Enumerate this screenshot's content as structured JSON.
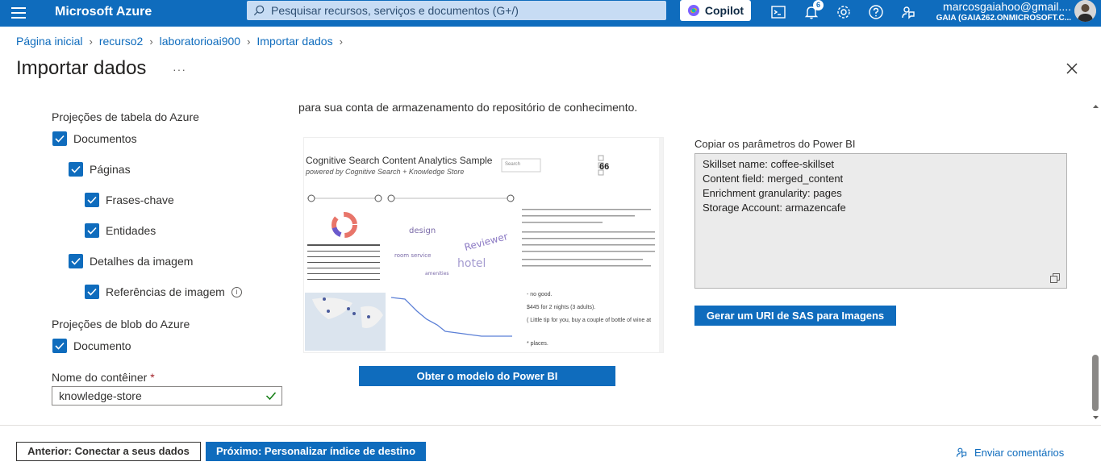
{
  "header": {
    "brand": "Microsoft Azure",
    "search_placeholder": "Pesquisar recursos, serviços e documentos (G+/)",
    "copilot_label": "Copilot",
    "notification_count": "6",
    "account_name": "marcosgaiahoo@gmail....",
    "account_tenant": "GAIA (GAIA262.ONMICROSOFT.C...",
    "icons": [
      "menu-icon",
      "search-icon",
      "cloud-shell-icon",
      "bell-icon",
      "settings-icon",
      "help-icon",
      "feedback-icon"
    ]
  },
  "breadcrumb": [
    "Página inicial",
    "recurso2",
    "laboratorioai900",
    "Importar dados"
  ],
  "page": {
    "title": "Importar dados",
    "more_label": "···"
  },
  "left": {
    "table_projections_label": "Projeções de tabela do Azure",
    "table_items": [
      {
        "label": "Documentos",
        "checked": true
      },
      {
        "label": "Páginas",
        "checked": true
      },
      {
        "label": "Frases-chave",
        "checked": true
      },
      {
        "label": "Entidades",
        "checked": true
      },
      {
        "label": "Detalhes da imagem",
        "checked": true
      },
      {
        "label": "Referências de imagem",
        "checked": true,
        "info": "i"
      }
    ],
    "blob_projections_label": "Projeções de blob do Azure",
    "blob_items": [
      {
        "label": "Documento",
        "checked": true
      }
    ],
    "container_label": "Nome do contêiner",
    "container_required": "*",
    "container_value": "knowledge-store"
  },
  "middle": {
    "intro_text": "para sua conta de armazenamento do repositório de conhecimento.",
    "preview": {
      "title": "Cognitive Search Content Analytics Sample",
      "subtitle": "powered by Cognitive Search + Knowledge Store",
      "kpi_value": "66",
      "search_label": "Search",
      "review_snippets": [
        "- no good.",
        "$445 for 2 nights (3 adults).",
        "( Little tip for you, buy a couple of bottle of wine at",
        "* places."
      ]
    },
    "button_label": "Obter o modelo do Power BI"
  },
  "right": {
    "copy_label": "Copiar os parâmetros do Power BI",
    "params": [
      "Skillset name: coffee-skillset",
      "Content field: merged_content",
      "Enrichment granularity: pages",
      "Storage Account: armazencafe"
    ],
    "sas_button_label": "Gerar um URI de SAS para Imagens"
  },
  "footer": {
    "previous_label": "Anterior: Conectar a seus dados",
    "next_label": "Próximo: Personalizar índice de destino",
    "feedback_label": "Enviar comentários"
  },
  "colors": {
    "accent": "#0f6cbd",
    "topbar": "#0f6cbd",
    "search_bg": "#c7dcf4"
  }
}
